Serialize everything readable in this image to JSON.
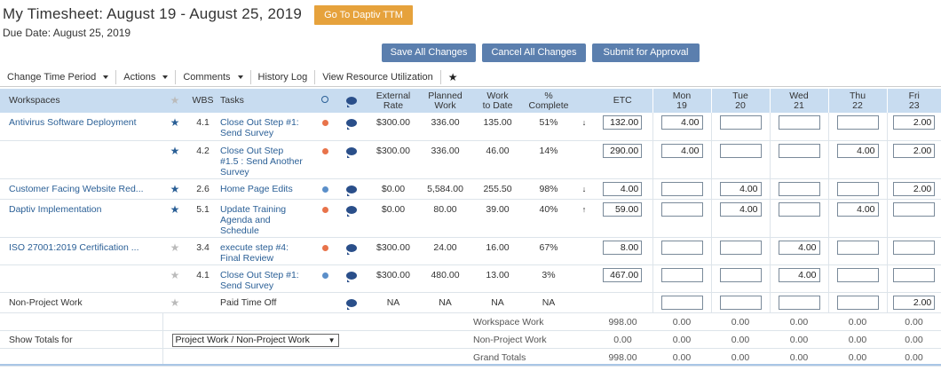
{
  "page": {
    "title": "My Timesheet: August 19 - August 25, 2019",
    "goto_label": "Go To Daptiv TTM",
    "due_date": "Due Date: August 25, 2019"
  },
  "actions": {
    "save": "Save All Changes",
    "cancel": "Cancel All Changes",
    "submit": "Submit for Approval"
  },
  "toolbar": {
    "change_period": "Change Time Period",
    "actions": "Actions",
    "comments": "Comments",
    "history": "History Log",
    "resource": "View Resource Utilization",
    "fav_icon": "star-icon"
  },
  "headers": {
    "workspaces": "Workspaces",
    "wbs": "WBS",
    "tasks": "Tasks",
    "ext_rate_1": "External",
    "ext_rate_2": "Rate",
    "planned_1": "Planned",
    "planned_2": "Work",
    "wtd_1": "Work",
    "wtd_2": "to Date",
    "pct_1": "%",
    "pct_2": "Complete",
    "etc": "ETC",
    "days": [
      {
        "name": "Mon",
        "date": "19"
      },
      {
        "name": "Tue",
        "date": "20"
      },
      {
        "name": "Wed",
        "date": "21"
      },
      {
        "name": "Thu",
        "date": "22"
      },
      {
        "name": "Fri",
        "date": "23"
      }
    ]
  },
  "rows": [
    {
      "workspace": "Antivirus Software Deployment",
      "wbs": "4.1",
      "task": "Close Out Step #1: Send Survey",
      "rate": "$300.00",
      "planned": "336.00",
      "to_date": "135.00",
      "pct": "51%",
      "arrow": "↓",
      "etc": "132.00",
      "days": [
        "4.00",
        "",
        "",
        "",
        "2.00"
      ]
    },
    {
      "workspace": "",
      "wbs": "4.2",
      "task": "Close Out Step #1.5 : Send Another Survey",
      "rate": "$300.00",
      "planned": "336.00",
      "to_date": "46.00",
      "pct": "14%",
      "arrow": "",
      "etc": "290.00",
      "days": [
        "4.00",
        "",
        "",
        "4.00",
        "2.00"
      ]
    },
    {
      "workspace": "Customer Facing Website Red...",
      "wbs": "2.6",
      "task": "Home Page Edits",
      "rate": "$0.00",
      "planned": "5,584.00",
      "to_date": "255.50",
      "pct": "98%",
      "arrow": "↓",
      "etc": "4.00",
      "days": [
        "",
        "4.00",
        "",
        "",
        "2.00"
      ]
    },
    {
      "workspace": "Daptiv Implementation",
      "wbs": "5.1",
      "task": "Update Training Agenda and Schedule",
      "rate": "$0.00",
      "planned": "80.00",
      "to_date": "39.00",
      "pct": "40%",
      "arrow": "↑",
      "etc": "59.00",
      "days": [
        "",
        "4.00",
        "",
        "4.00",
        ""
      ]
    },
    {
      "workspace": "ISO 27001:2019 Certification ...",
      "wbs": "3.4",
      "task": "execute step #4: Final Review",
      "rate": "$300.00",
      "planned": "24.00",
      "to_date": "16.00",
      "pct": "67%",
      "arrow": "",
      "etc": "8.00",
      "days": [
        "",
        "",
        "4.00",
        "",
        ""
      ]
    },
    {
      "workspace": "",
      "wbs": "4.1",
      "task": "Close Out Step #1: Send Survey",
      "rate": "$300.00",
      "planned": "480.00",
      "to_date": "13.00",
      "pct": "3%",
      "arrow": "",
      "etc": "467.00",
      "days": [
        "",
        "",
        "4.00",
        "",
        ""
      ]
    }
  ],
  "non_project": {
    "workspace": "Non-Project Work",
    "task": "Paid Time Off",
    "na": "NA",
    "days": [
      "",
      "",
      "",
      "",
      "2.00"
    ]
  },
  "totals": {
    "show_label": "Show Totals for",
    "select_value": "Project Work / Non-Project Work",
    "workspace_label": "Workspace Work",
    "workspace_etc": "998.00",
    "workspace_days": [
      "0.00",
      "0.00",
      "0.00",
      "0.00",
      "0.00"
    ],
    "nonproject_label": "Non-Project Work",
    "nonproject_etc": "0.00",
    "nonproject_days": [
      "0.00",
      "0.00",
      "0.00",
      "0.00",
      "0.00"
    ],
    "grand_label": "Grand Totals",
    "grand_etc": "998.00",
    "grand_days": [
      "0.00",
      "0.00",
      "0.00",
      "0.00",
      "0.00"
    ]
  },
  "colors": {
    "accent_orange": "#e6a23c",
    "button_blue": "#5b7fae",
    "header_bg": "#c8dcf0",
    "link_blue": "#2a5f96"
  }
}
